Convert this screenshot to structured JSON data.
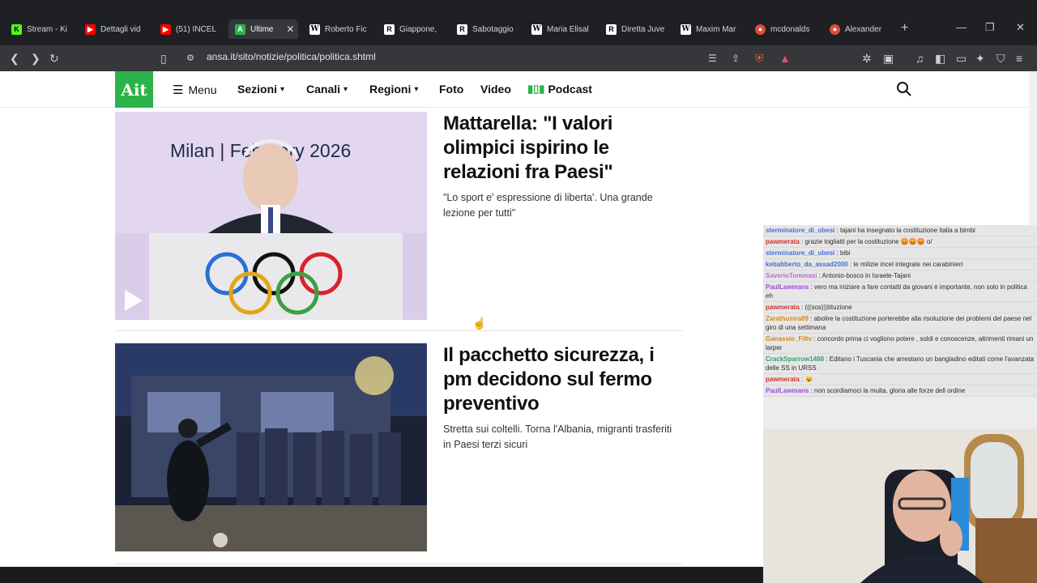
{
  "browser": {
    "tabs": [
      {
        "label": "Stream - Ki",
        "icon": "kick-icon",
        "color": "#53fc18"
      },
      {
        "label": "Dettagli vid",
        "icon": "youtube-icon",
        "color": "#ff0000"
      },
      {
        "label": "(51) INCEL",
        "icon": "youtube-icon",
        "color": "#ff0000"
      },
      {
        "label": "Ultime",
        "icon": "ansa-icon",
        "color": "#2bb34a",
        "active": true
      },
      {
        "label": "Roberto Fic",
        "icon": "wikipedia-icon",
        "color": "#ffffff"
      },
      {
        "label": "Giappone,",
        "icon": "r-icon",
        "color": "#ffffff"
      },
      {
        "label": "Sabotaggio",
        "icon": "r-icon",
        "color": "#ffffff"
      },
      {
        "label": "Maria Elisal",
        "icon": "wikipedia-icon",
        "color": "#ffffff"
      },
      {
        "label": "Diretta Juve",
        "icon": "r-icon",
        "color": "#ffffff"
      },
      {
        "label": "Maxim Mar",
        "icon": "wikipedia-icon",
        "color": "#ffffff"
      },
      {
        "label": "mcdonalds",
        "icon": "brave-search-icon",
        "color": "#e04b3a"
      },
      {
        "label": "Alexander",
        "icon": "brave-search-icon",
        "color": "#e04b3a"
      }
    ],
    "url": "ansa.it/sito/notizie/politica/politica.shtml"
  },
  "site": {
    "logo": "Ait",
    "menu_label": "Menu",
    "nav": [
      {
        "label": "Sezioni",
        "dropdown": true
      },
      {
        "label": "Canali",
        "dropdown": true
      },
      {
        "label": "Regioni",
        "dropdown": true
      },
      {
        "label": "Foto",
        "dropdown": false
      },
      {
        "label": "Video",
        "dropdown": false
      },
      {
        "label": "Podcast",
        "dropdown": false
      }
    ],
    "brand_color": "#2bb34a"
  },
  "articles": [
    {
      "headline": "Mattarella: \"I valori olimpici ispirino le relazioni fra Paesi\"",
      "summary": "\"Lo sport e' espressione di liberta'. Una grande lezione per tutti\"",
      "image_text": "Milan | February 2026",
      "has_video": true
    },
    {
      "headline": "Il pacchetto sicurezza, i pm decidono sul fermo preventivo",
      "summary": "Stretta sui coltelli. Torna l'Albania, migranti trasferiti in Paesi terzi sicuri",
      "has_video": false
    }
  ],
  "chat": [
    {
      "user": "sterminatore_di_obesi",
      "color": "#4a6fd1",
      "text": ": tajani ha insegnato la costituzione italia a bimbi"
    },
    {
      "user": "pawmerata",
      "color": "#d0312d",
      "text": ": grazie togliatti per la costituzione 😡😡😡 o/"
    },
    {
      "user": "sterminatore_di_obesi",
      "color": "#4a6fd1",
      "text": ": bibi"
    },
    {
      "user": "kebabberto_da_assad2000",
      "color": "#3b6fd6",
      "text": ": le milizie incel integrate nei carabinieri"
    },
    {
      "user": "SaverioTommasi",
      "color": "#b56bd6",
      "text": ": Antonio-bosco in Israele-Tajani"
    },
    {
      "user": "PaulLawmans",
      "color": "#9a4fd0",
      "text": ": vero ma iniziare a fare contatti da giovani è importante, non solo in politica eh"
    },
    {
      "user": "pawmerata",
      "color": "#d0312d",
      "text": ": (((sos)))tituzione"
    },
    {
      "user": "Zarathustra89",
      "color": "#d48a1f",
      "text": ": abolire la costituzione porterebbe alla risoluzione dei problemi del paese nel giro di una settimana"
    },
    {
      "user": "Ganassio_Filtv",
      "color": "#d8831a",
      "text": ": concordo prima ci vogliono potere , soldi e conoscenze, altrimenti rimani un larper"
    },
    {
      "user": "CrackSparrow1488",
      "color": "#2fa36b",
      "text": ": Editano i Tuscania che arrestano un bangladino editati come l'avanzata delle SS in URSS"
    },
    {
      "user": "pawmerata",
      "color": "#d0312d",
      "text": ": 😺"
    },
    {
      "user": "PaulLawmans",
      "color": "#9a4fd0",
      "text": ": non scordiamoci la multa, gloria alle forze dell ordine"
    }
  ]
}
